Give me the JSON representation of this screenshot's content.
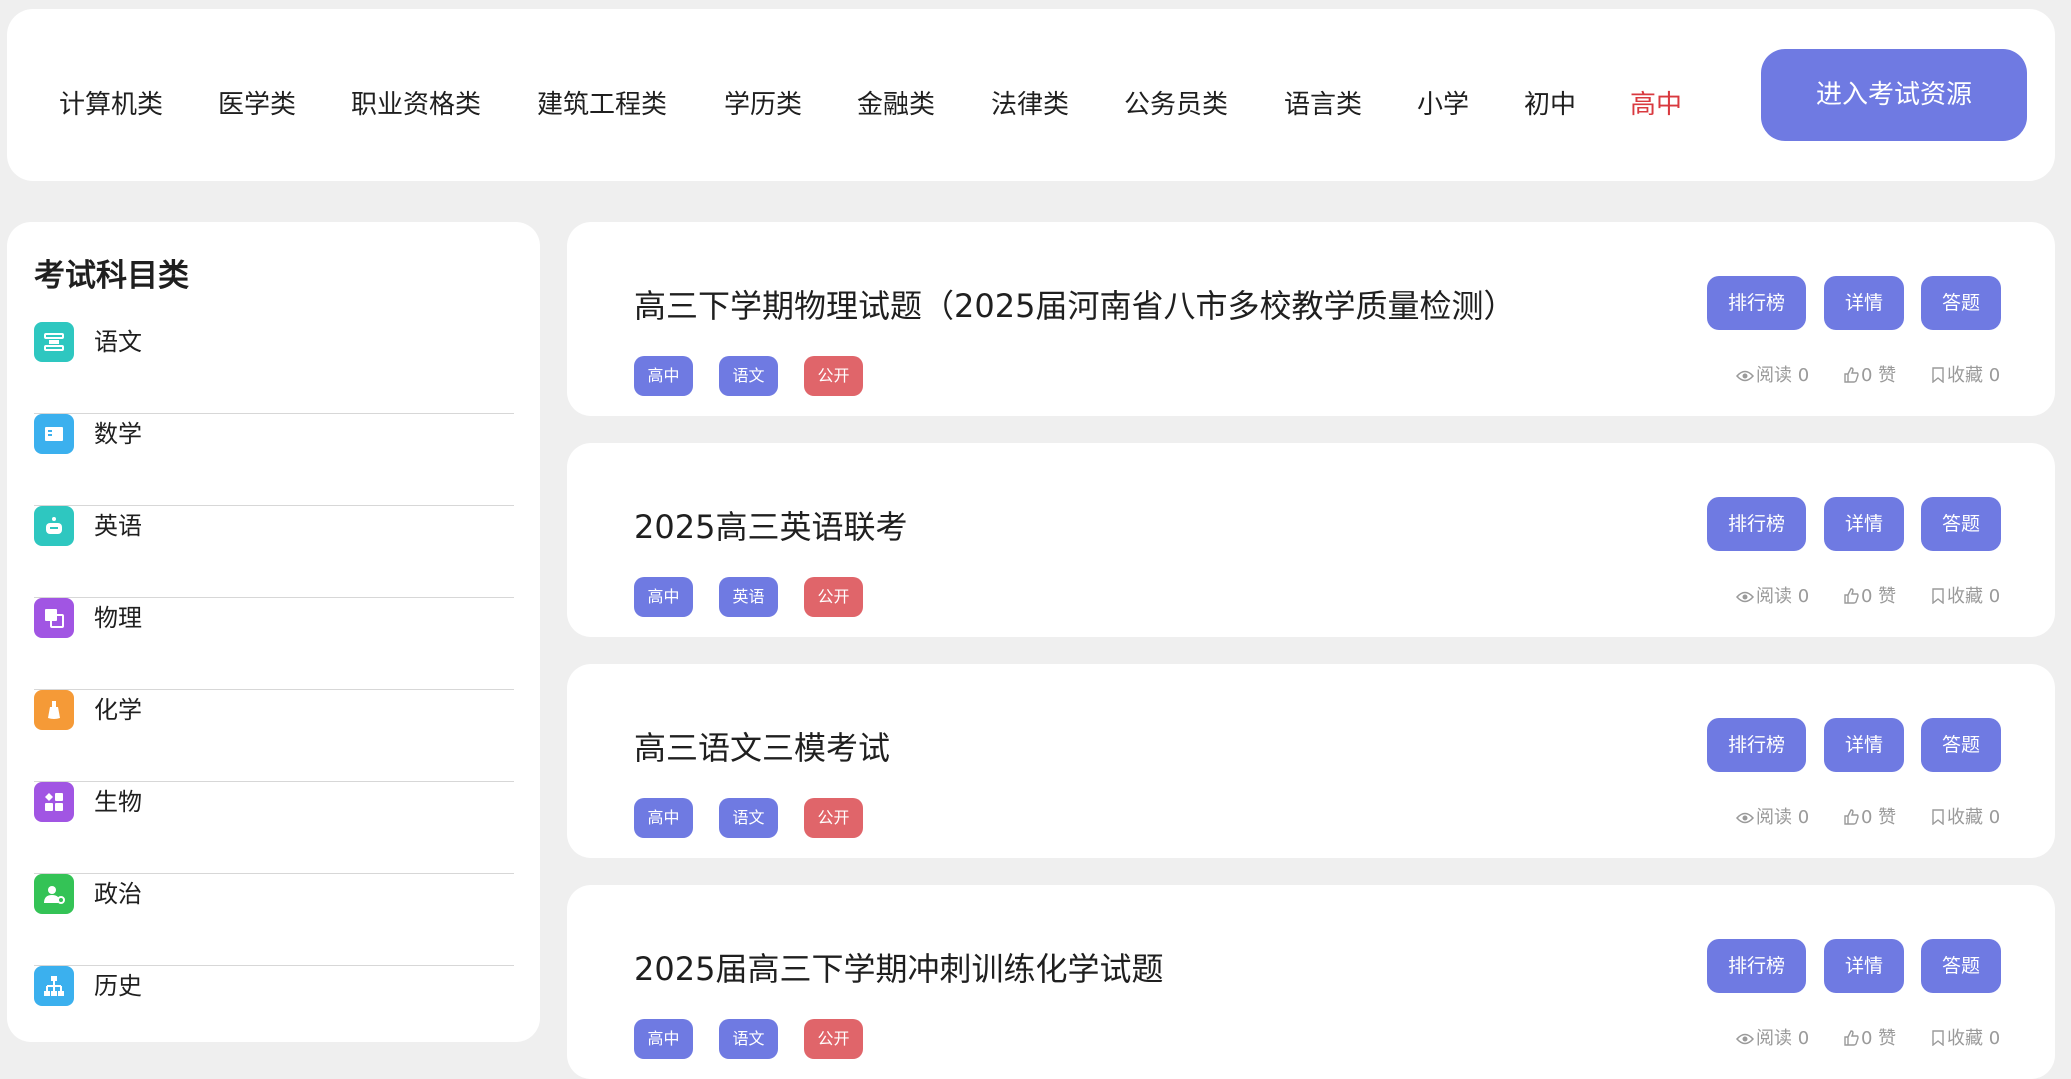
{
  "nav": {
    "items": [
      "计算机类",
      "医学类",
      "职业资格类",
      "建筑工程类",
      "学历类",
      "金融类",
      "法律类",
      "公务员类",
      "语言类",
      "小学",
      "初中",
      "高中"
    ],
    "active": "高中",
    "enter_label": "进入考试资源"
  },
  "sidebar": {
    "title": "考试科目类",
    "items": [
      {
        "label": "语文",
        "icon": "list-icon",
        "color": "#2ec7c0"
      },
      {
        "label": "数学",
        "icon": "book-icon",
        "color": "#3bb0ee"
      },
      {
        "label": "英语",
        "icon": "robot-icon",
        "color": "#2ec7c0"
      },
      {
        "label": "物理",
        "icon": "copy-icon",
        "color": "#a155e3"
      },
      {
        "label": "化学",
        "icon": "flask-icon",
        "color": "#f59a37"
      },
      {
        "label": "生物",
        "icon": "grid-icon",
        "color": "#a155e3"
      },
      {
        "label": "政治",
        "icon": "user-icon",
        "color": "#34c356"
      },
      {
        "label": "历史",
        "icon": "hierarchy-icon",
        "color": "#3bb0ee"
      }
    ]
  },
  "cards": [
    {
      "title": "高三下学期物理试题（2025届河南省八市多校教学质量检测）",
      "tags": [
        "高中",
        "语文",
        "公开"
      ],
      "views": "阅读 0",
      "likes": "0 赞",
      "favs": "收藏 0"
    },
    {
      "title": "2025高三英语联考",
      "tags": [
        "高中",
        "英语",
        "公开"
      ],
      "views": "阅读 0",
      "likes": "0 赞",
      "favs": "收藏 0"
    },
    {
      "title": "高三语文三模考试",
      "tags": [
        "高中",
        "语文",
        "公开"
      ],
      "views": "阅读 0",
      "likes": "0 赞",
      "favs": "收藏 0"
    },
    {
      "title": "2025届高三下学期冲刺训练化学试题",
      "tags": [
        "高中",
        "语文",
        "公开"
      ],
      "views": "阅读 0",
      "likes": "0 赞",
      "favs": "收藏 0"
    }
  ],
  "buttons": {
    "rank": "排行榜",
    "detail": "详情",
    "answer": "答题"
  },
  "colors": {
    "accent": "#6f7ae2",
    "public_tag": "#e0656a",
    "active_nav": "#d9393f"
  }
}
